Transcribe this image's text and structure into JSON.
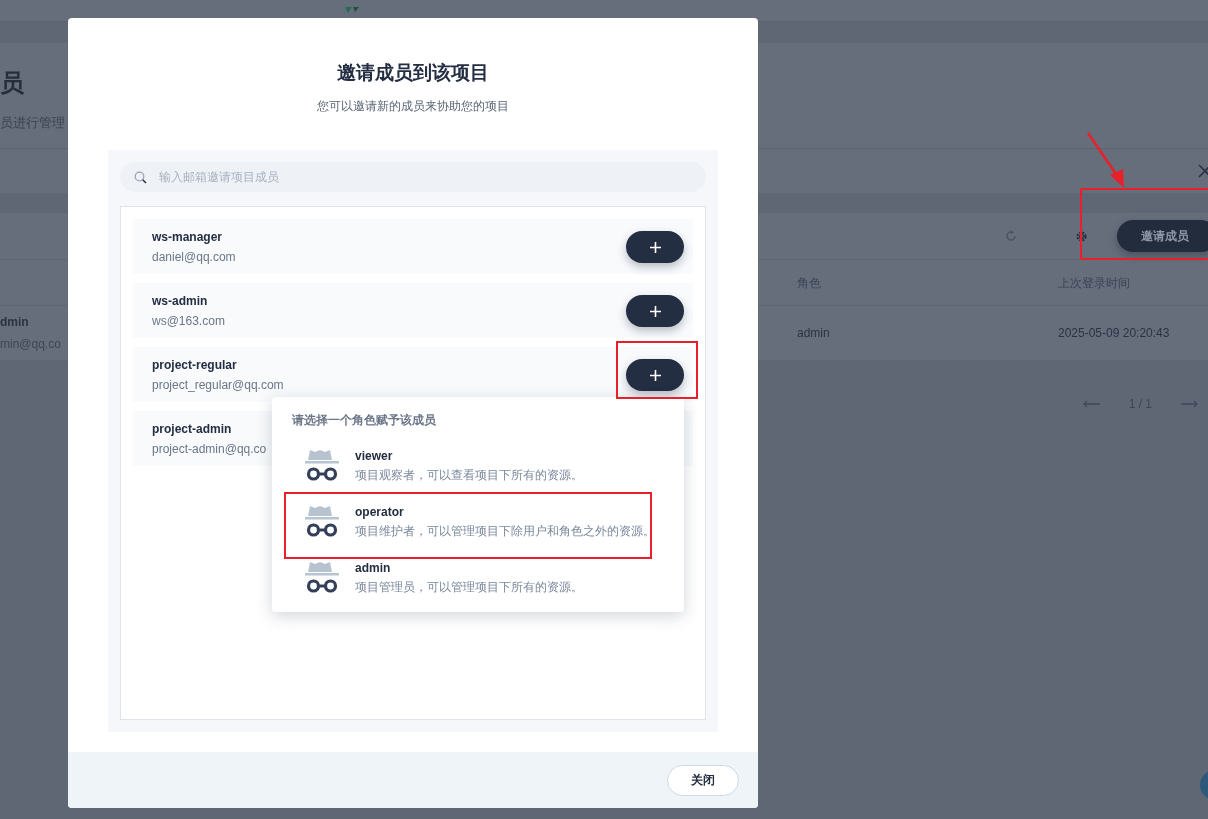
{
  "background_page": {
    "title": "员",
    "subtitle": "员进行管理",
    "toolbar": {
      "invite_button": "邀请成员"
    },
    "table": {
      "columns": [
        "角色",
        "上次登录时间"
      ],
      "rows": [
        {
          "name": "dmin",
          "email": "min@qq.co",
          "role": "admin",
          "last_login": "2025-05-09 20:20:43"
        }
      ]
    },
    "pagination": {
      "page": "1 / 1"
    }
  },
  "modal": {
    "title": "邀请成员到该项目",
    "subtitle": "您可以邀请新的成员来协助您的项目",
    "search": {
      "placeholder": "输入邮箱邀请项目成员"
    },
    "users": [
      {
        "name": "ws-manager",
        "email": "daniel@qq.com",
        "role_menu_open": false
      },
      {
        "name": "ws-admin",
        "email": "ws@163.com",
        "role_menu_open": false
      },
      {
        "name": "project-regular",
        "email": "project_regular@qq.com",
        "role_menu_open": true
      },
      {
        "name": "project-admin",
        "email": "project-admin@qq.co",
        "role_menu_open": false
      }
    ],
    "role_menu": {
      "heading": "请选择一个角色赋予该成员",
      "roles": [
        {
          "name": "viewer",
          "description": "项目观察者，可以查看项目下所有的资源。"
        },
        {
          "name": "operator",
          "description": "项目维护者，可以管理项目下除用户和角色之外的资源。"
        },
        {
          "name": "admin",
          "description": "项目管理员，可以管理项目下所有的资源。"
        }
      ]
    },
    "close_button": "关闭"
  }
}
